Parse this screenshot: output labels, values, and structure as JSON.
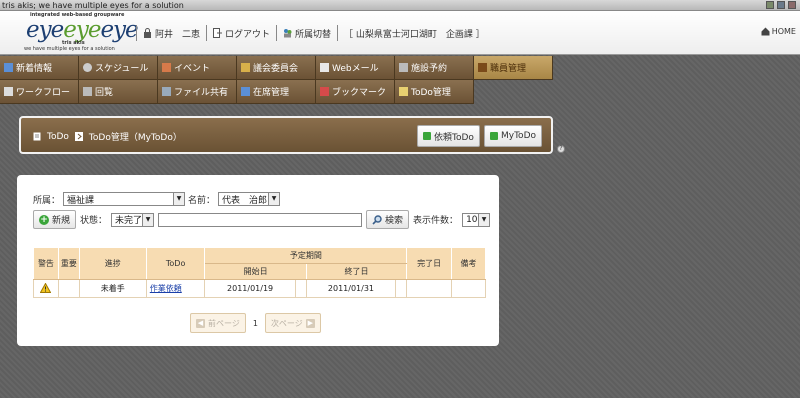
{
  "window": {
    "title": "tris akis; we have multiple eyes for a solution"
  },
  "logo": {
    "tagline": "integrated web-based groupware",
    "wordmark_a": "eye",
    "wordmark_b": "eye",
    "wordmark_c": "eye",
    "company": "tris akis",
    "slogan": "we have multiple eyes for a solution"
  },
  "header": {
    "user_name": "阿井　二恵",
    "logout_label": "ログアウト",
    "switch_label": "所属切替",
    "org_label": "［ 山梨県富士河口湖町　企画課 ］",
    "home_label": "HOME"
  },
  "nav": {
    "row1": [
      {
        "label": "新着情報",
        "icon": "news-icon"
      },
      {
        "label": "スケジュール",
        "icon": "schedule-icon"
      },
      {
        "label": "イベント",
        "icon": "event-icon"
      },
      {
        "label": "議会委員会",
        "icon": "council-icon"
      },
      {
        "label": "Webメール",
        "icon": "mail-icon"
      },
      {
        "label": "施設予約",
        "icon": "facility-icon"
      },
      {
        "label": "職員管理",
        "icon": "staff-icon"
      }
    ],
    "row2": [
      {
        "label": "ワークフロー",
        "icon": "workflow-icon"
      },
      {
        "label": "回覧",
        "icon": "circular-icon"
      },
      {
        "label": "ファイル共有",
        "icon": "file-share-icon"
      },
      {
        "label": "在席管理",
        "icon": "presence-icon"
      },
      {
        "label": "ブックマーク",
        "icon": "bookmark-icon"
      },
      {
        "label": "ToDo管理",
        "icon": "todo-icon"
      }
    ]
  },
  "breadcrumb": {
    "item1": "ToDo",
    "item2": "ToDo管理（MyToDo）",
    "btn_request": "依頼ToDo",
    "btn_my": "MyToDo"
  },
  "filters": {
    "dept_label": "所属：",
    "dept_value": "福祉課",
    "name_label": "名前：",
    "name_value": "代表　治郎",
    "new_label": "新規",
    "status_label": "状態：",
    "status_value": "未完了",
    "search_value": "",
    "search_label": "検索",
    "count_label": "表示件数：",
    "count_value": "10"
  },
  "table": {
    "headers": {
      "warning": "警告",
      "important": "重要",
      "progress": "進捗",
      "todo": "ToDo",
      "planned": "予定期間",
      "start": "開始日",
      "end": "終了日",
      "done": "完了日",
      "note": "備考"
    },
    "rows": [
      {
        "progress": "未着手",
        "todo": "作業依頼",
        "start": "2011/01/19",
        "end": "2011/01/31",
        "done": "",
        "note": ""
      }
    ]
  },
  "pager": {
    "prev": "前ページ",
    "page": "1",
    "next": "次ページ"
  },
  "colors": {
    "nav_bg": "#6b5235",
    "nav_active": "#c9a86a",
    "header_cell": "#f7dcb2",
    "link": "#1a3fa8"
  }
}
